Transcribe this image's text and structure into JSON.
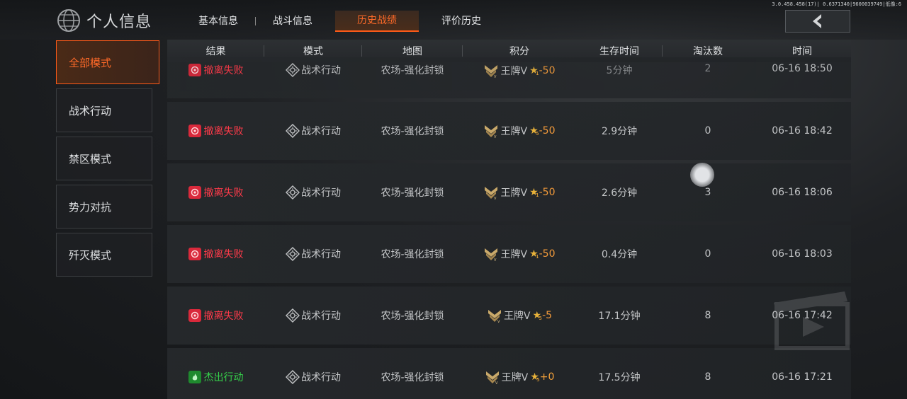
{
  "header": {
    "title": "个人信息",
    "debug_text": "3.0.458.458(17)| 0.6371340|9600039749|低像:6",
    "tabs": [
      {
        "label": "基本信息",
        "active": false
      },
      {
        "label": "战斗信息",
        "active": false
      },
      {
        "label": "历史战绩",
        "active": true
      },
      {
        "label": "评价历史",
        "active": false
      }
    ],
    "back_label": "back"
  },
  "sidebar": {
    "items": [
      {
        "label": "全部模式",
        "active": true
      },
      {
        "label": "战术行动",
        "active": false
      },
      {
        "label": "禁区模式",
        "active": false
      },
      {
        "label": "势力对抗",
        "active": false
      },
      {
        "label": "歼灭模式",
        "active": false
      }
    ]
  },
  "table": {
    "columns": [
      "结果",
      "模式",
      "地图",
      "积分",
      "生存时间",
      "淘汰数",
      "时间"
    ],
    "rows": [
      {
        "result": "撤离失败",
        "result_type": "fail",
        "mode": "战术行动",
        "map": "农场-强化封锁",
        "rank": "王牌V",
        "star_level": "1",
        "score": "-50",
        "survival": "5分钟",
        "kills": "2",
        "time": "06-16 18:50"
      },
      {
        "result": "撤离失败",
        "result_type": "fail",
        "mode": "战术行动",
        "map": "农场-强化封锁",
        "rank": "王牌V",
        "star_level": "5",
        "score": "-50",
        "survival": "2.9分钟",
        "kills": "0",
        "time": "06-16 18:42"
      },
      {
        "result": "撤离失败",
        "result_type": "fail",
        "mode": "战术行动",
        "map": "农场-强化封锁",
        "rank": "王牌V",
        "star_level": "1",
        "score": "-50",
        "survival": "2.6分钟",
        "kills": "3",
        "time": "06-16 18:06"
      },
      {
        "result": "撤离失败",
        "result_type": "fail",
        "mode": "战术行动",
        "map": "农场-强化封锁",
        "rank": "王牌V",
        "star_level": "1",
        "score": "-50",
        "survival": "0.4分钟",
        "kills": "0",
        "time": "06-16 18:03"
      },
      {
        "result": "撤离失败",
        "result_type": "fail",
        "mode": "战术行动",
        "map": "农场-强化封锁",
        "rank": "王牌V",
        "star_level": "5",
        "score": "-5",
        "survival": "17.1分钟",
        "kills": "8",
        "time": "06-16 17:42"
      },
      {
        "result": "杰出行动",
        "result_type": "ok",
        "mode": "战术行动",
        "map": "农场-强化封锁",
        "rank": "王牌V",
        "star_level": "5",
        "score": "+0",
        "survival": "17.5分钟",
        "kills": "8",
        "time": "06-16 17:21"
      }
    ]
  },
  "colors": {
    "accent": "#ff5a18",
    "fail": "#ff3b4a",
    "success": "#35d04a",
    "score": "#f29a3a"
  }
}
